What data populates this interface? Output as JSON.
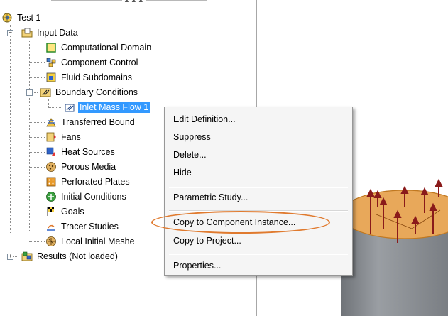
{
  "tree": {
    "root": {
      "label": "Test 1",
      "icon": "project-icon"
    },
    "input_data": {
      "label": "Input Data",
      "icon": "folder-data-icon",
      "expander": "−"
    },
    "children": [
      {
        "label": "Computational Domain",
        "icon": "domain-icon"
      },
      {
        "label": "Component Control",
        "icon": "component-control-icon"
      },
      {
        "label": "Fluid Subdomains",
        "icon": "fluid-subdomain-icon"
      }
    ],
    "boundary_conditions": {
      "label": "Boundary Conditions",
      "icon": "boundary-conditions-icon",
      "expander": "−"
    },
    "inlet_mass_flow": {
      "label": "Inlet Mass Flow 1",
      "icon": "inlet-flow-icon",
      "selected": true
    },
    "rest": [
      {
        "label": "Transferred Bound",
        "icon": "transferred-boundary-icon"
      },
      {
        "label": "Fans",
        "icon": "fan-icon"
      },
      {
        "label": "Heat Sources",
        "icon": "heat-source-icon"
      },
      {
        "label": "Porous Media",
        "icon": "porous-media-icon"
      },
      {
        "label": "Perforated Plates",
        "icon": "perforated-plate-icon"
      },
      {
        "label": "Initial Conditions",
        "icon": "initial-conditions-icon"
      },
      {
        "label": "Goals",
        "icon": "goal-flag-icon"
      },
      {
        "label": "Tracer Studies",
        "icon": "tracer-study-icon"
      },
      {
        "label": "Local Initial Meshe",
        "icon": "local-mesh-icon"
      }
    ],
    "results": {
      "label": "Results (Not loaded)",
      "icon": "results-icon",
      "expander": "+"
    }
  },
  "panel_grip": "▲▲▲",
  "context_menu": {
    "items": [
      "Edit Definition...",
      "Suppress",
      "Delete...",
      "Hide",
      "Parametric Study...",
      "Copy to Component Instance...",
      "Copy to Project...",
      "Properties..."
    ],
    "highlighted_item": "Copy to Component Instance...",
    "highlight_color": "#e07a2e"
  },
  "colors": {
    "selection": "#3399ff",
    "cylinder_top": "#e8a85a",
    "cylinder_side": "#8c8f94",
    "arrow": "#8a1a1a"
  }
}
